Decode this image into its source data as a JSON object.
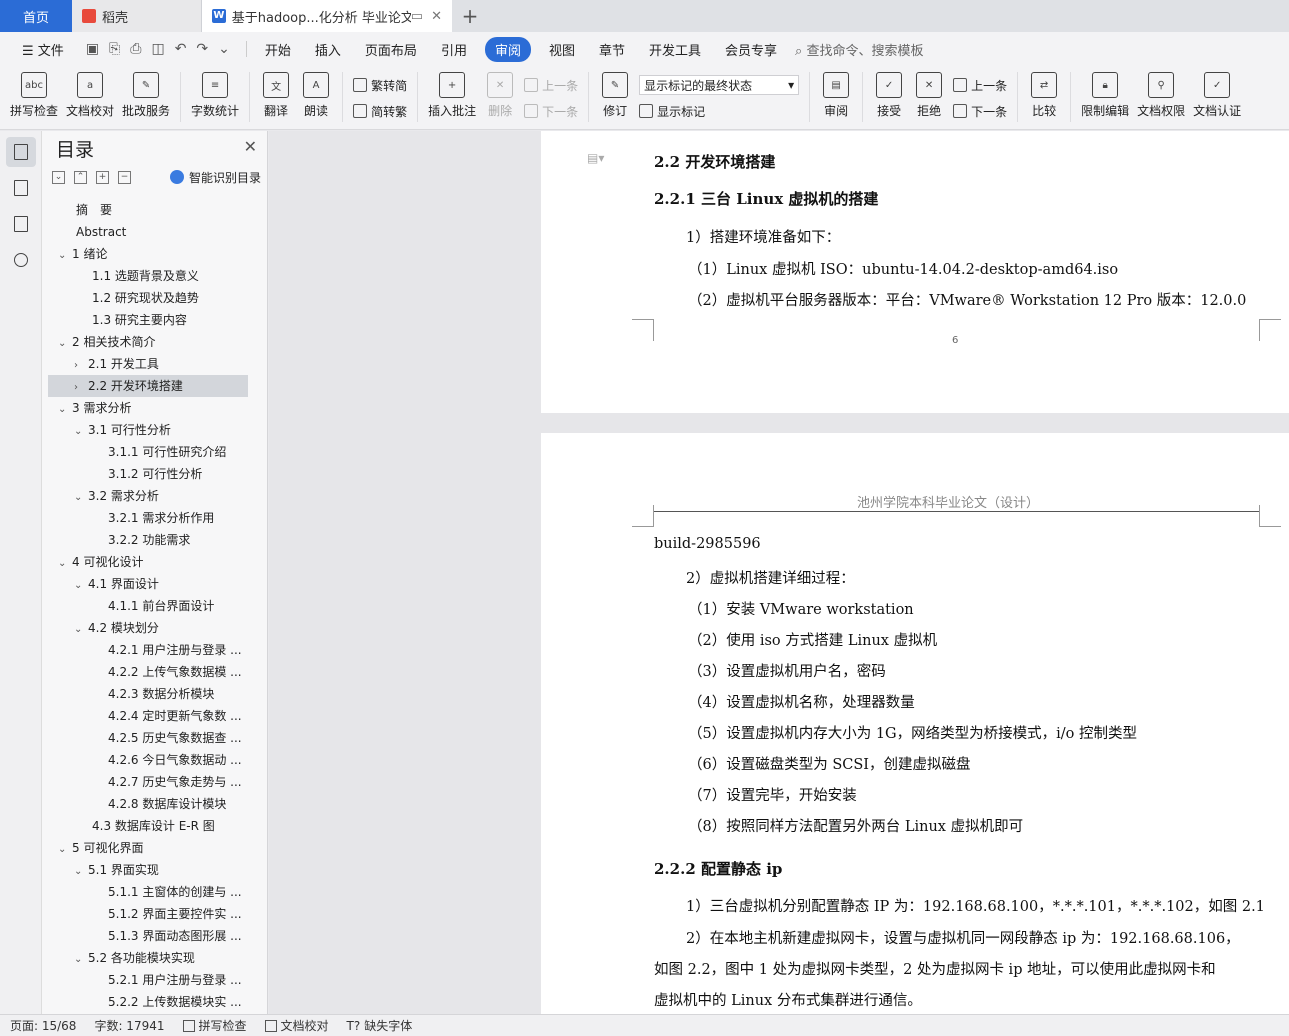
{
  "tabs": [
    {
      "label": "首页"
    },
    {
      "label": "稻壳"
    },
    {
      "label": "基于hadoop...化分析 毕业论文"
    }
  ],
  "menu": {
    "file": "文件",
    "items": [
      "开始",
      "插入",
      "页面布局",
      "引用",
      "审阅",
      "视图",
      "章节",
      "开发工具",
      "会员专享"
    ],
    "active": "审阅",
    "search": "查找命令、搜索模板"
  },
  "ribbon": {
    "spell": "拼写检查",
    "doccheck": "文档校对",
    "batch": "批改服务",
    "wordcount": "字数统计",
    "translate": "翻译",
    "read": "朗读",
    "trad": "繁转简",
    "simp": "简转繁",
    "insert_comment": "插入批注",
    "delete": "删除",
    "prev_comment": "上一条",
    "next_comment": "下一条",
    "revise": "修订",
    "markup_select": "显示标记的最终状态",
    "show_markup": "显示标记",
    "review": "审阅",
    "accept": "接受",
    "reject": "拒绝",
    "prev": "上一条",
    "next": "下一条",
    "compare": "比较",
    "restrict": "限制编辑",
    "perm": "文档权限",
    "cert": "文档认证"
  },
  "toc": {
    "title": "目录",
    "ai": "智能识别目录",
    "items": [
      {
        "t": "摘　要",
        "lvl": 0,
        "arrow": ""
      },
      {
        "t": "Abstract",
        "lvl": 0,
        "arrow": ""
      },
      {
        "t": "1 绪论",
        "lvl": 0,
        "arrow": "v"
      },
      {
        "t": "1.1 选题背景及意义",
        "lvl": 1,
        "arrow": ""
      },
      {
        "t": "1.2 研究现状及趋势",
        "lvl": 1,
        "arrow": ""
      },
      {
        "t": "1.3 研究主要内容",
        "lvl": 1,
        "arrow": ""
      },
      {
        "t": "2 相关技术简介",
        "lvl": 0,
        "arrow": "v"
      },
      {
        "t": "2.1 开发工具",
        "lvl": 1,
        "arrow": ">"
      },
      {
        "t": "2.2 开发环境搭建",
        "lvl": 1,
        "arrow": ">"
      },
      {
        "t": "3  需求分析",
        "lvl": 0,
        "arrow": "v"
      },
      {
        "t": "3.1 可行性分析",
        "lvl": 1,
        "arrow": "v"
      },
      {
        "t": "3.1.1 可行性研究介绍",
        "lvl": 2,
        "arrow": ""
      },
      {
        "t": "3.1.2 可行性分析",
        "lvl": 2,
        "arrow": ""
      },
      {
        "t": "3.2 需求分析",
        "lvl": 1,
        "arrow": "v"
      },
      {
        "t": "3.2.1 需求分析作用",
        "lvl": 2,
        "arrow": ""
      },
      {
        "t": "3.2.2 功能需求",
        "lvl": 2,
        "arrow": ""
      },
      {
        "t": "4  可视化设计",
        "lvl": 0,
        "arrow": "v"
      },
      {
        "t": "4.1 界面设计",
        "lvl": 1,
        "arrow": "v"
      },
      {
        "t": "4.1.1 前台界面设计",
        "lvl": 2,
        "arrow": ""
      },
      {
        "t": "4.2 模块划分",
        "lvl": 1,
        "arrow": "v"
      },
      {
        "t": "4.2.1 用户注册与登录 ...",
        "lvl": 2,
        "arrow": ""
      },
      {
        "t": "4.2.2 上传气象数据模 ...",
        "lvl": 2,
        "arrow": ""
      },
      {
        "t": "4.2.3 数据分析模块",
        "lvl": 2,
        "arrow": ""
      },
      {
        "t": "4.2.4 定时更新气象数 ...",
        "lvl": 2,
        "arrow": ""
      },
      {
        "t": "4.2.5 历史气象数据查 ...",
        "lvl": 2,
        "arrow": ""
      },
      {
        "t": "4.2.6 今日气象数据动 ...",
        "lvl": 2,
        "arrow": ""
      },
      {
        "t": "4.2.7 历史气象走势与 ...",
        "lvl": 2,
        "arrow": ""
      },
      {
        "t": "4.2.8 数据库设计模块",
        "lvl": 2,
        "arrow": ""
      },
      {
        "t": "4.3 数据库设计 E-R 图",
        "lvl": 1,
        "arrow": ""
      },
      {
        "t": "5  可视化界面",
        "lvl": 0,
        "arrow": "v"
      },
      {
        "t": "5.1 界面实现",
        "lvl": 1,
        "arrow": "v"
      },
      {
        "t": "5.1.1 主窗体的创建与 ...",
        "lvl": 2,
        "arrow": ""
      },
      {
        "t": "5.1.2  界面主要控件实 ...",
        "lvl": 2,
        "arrow": ""
      },
      {
        "t": "5.1.3 界面动态图形展 ...",
        "lvl": 2,
        "arrow": ""
      },
      {
        "t": "5.2 各功能模块实现",
        "lvl": 1,
        "arrow": "v"
      },
      {
        "t": "5.2.1 用户注册与登录 ...",
        "lvl": 2,
        "arrow": ""
      },
      {
        "t": "5.2.2 上传数据模块实 ...",
        "lvl": 2,
        "arrow": ""
      }
    ]
  },
  "doc": {
    "p1": {
      "h1": "2.2 开发环境搭建",
      "h2": "2.2.1  三台 Linux 虚拟机的搭建",
      "l1": "1）搭建环境准备如下：",
      "l2": "（1）Linux 虚拟机 ISO：ubuntu-14.04.2-desktop-amd64.iso",
      "l3": "（2）虚拟机平台服务器版本：平台：VMware® Workstation 12 Pro 版本：12.0.0",
      "pagenum": "6"
    },
    "p2": {
      "header": "池州学院本科毕业论文（设计）",
      "l0": "build-2985596",
      "l1": "2）虚拟机搭建详细过程：",
      "steps": [
        "（1）安装 VMware workstation",
        "（2）使用 iso 方式搭建 Linux 虚拟机",
        "（3）设置虚拟机用户名，密码",
        "（4）设置虚拟机名称，处理器数量",
        "（5）设置虚拟机内存大小为 1G，网络类型为桥接模式，i/o 控制类型",
        "（6）设置磁盘类型为 SCSI，创建虚拟磁盘",
        "（7）设置完毕，开始安装",
        "（8）按照同样方法配置另外两台 Linux 虚拟机即可"
      ],
      "h2": "2.2.2  配置静态 ip",
      "a1": "1）三台虚拟机分别配置静态 IP 为：192.168.68.100，*.*.*.101，*.*.*.102，如图 2.1",
      "a2": "2）在本地主机新建虚拟网卡，设置与虚拟机同一网段静态 ip 为：192.168.68.106，",
      "a3": "如图 2.2，图中 1 处为虚拟网卡类型，2 处为虚拟网卡 ip 地址，可以使用此虚拟网卡和",
      "a4": "虚拟机中的 Linux 分布式集群进行通信。"
    }
  },
  "status": {
    "page": "页面: 15/68",
    "words": "字数: 17941",
    "spell": "拼写检查",
    "proof": "文档校对",
    "font": "缺失字体"
  }
}
